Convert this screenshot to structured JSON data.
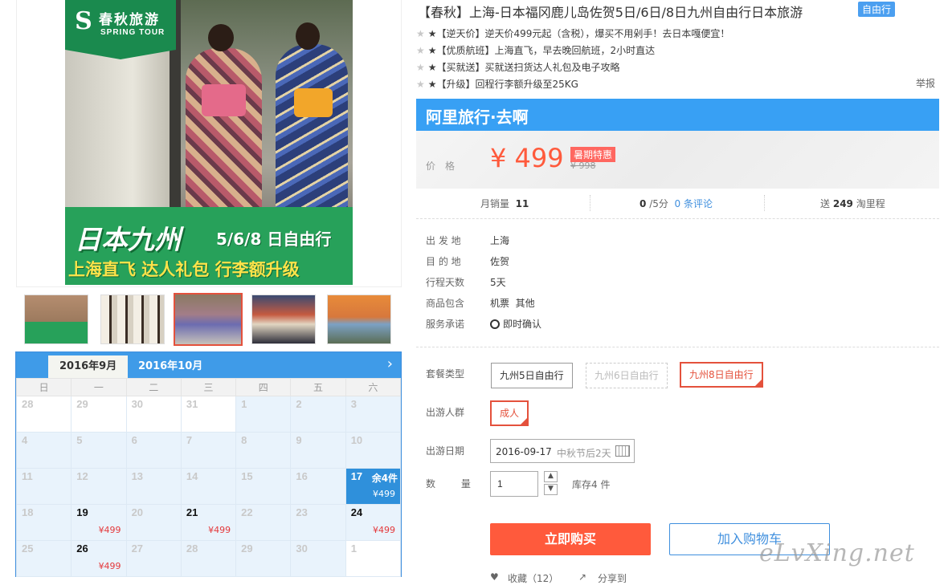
{
  "logo": {
    "mark": "S",
    "name_cn": "春秋旅游",
    "name_en": "SPRING TOUR"
  },
  "banner": {
    "title": "日本九州",
    "subtitle": "5/6/8 日自由行",
    "tagline": "上海直飞  达人礼包  行李额升级"
  },
  "calendar": {
    "tabs": [
      "2016年9月",
      "2016年10月"
    ],
    "next_icon": "chevron-right-icon",
    "weekdays": [
      "日",
      "一",
      "二",
      "三",
      "四",
      "五",
      "六"
    ],
    "weeks": [
      [
        {
          "d": "28",
          "s": "past"
        },
        {
          "d": "29",
          "s": "past"
        },
        {
          "d": "30",
          "s": "past"
        },
        {
          "d": "31",
          "s": "past"
        },
        {
          "d": "1",
          "s": "avail"
        },
        {
          "d": "2",
          "s": "avail"
        },
        {
          "d": "3",
          "s": "avail"
        }
      ],
      [
        {
          "d": "4",
          "s": "avail"
        },
        {
          "d": "5",
          "s": "avail"
        },
        {
          "d": "6",
          "s": "avail"
        },
        {
          "d": "7",
          "s": "avail"
        },
        {
          "d": "8",
          "s": "avail"
        },
        {
          "d": "9",
          "s": "avail"
        },
        {
          "d": "10",
          "s": "avail"
        }
      ],
      [
        {
          "d": "11",
          "s": "avail"
        },
        {
          "d": "12",
          "s": "avail"
        },
        {
          "d": "13",
          "s": "avail"
        },
        {
          "d": "14",
          "s": "avail"
        },
        {
          "d": "15",
          "s": "avail"
        },
        {
          "d": "16",
          "s": "avail"
        },
        {
          "d": "17",
          "s": "selected",
          "price": "¥499",
          "stock": "余4件"
        }
      ],
      [
        {
          "d": "18",
          "s": "avail"
        },
        {
          "d": "19",
          "s": "has",
          "price": "¥499"
        },
        {
          "d": "20",
          "s": "avail"
        },
        {
          "d": "21",
          "s": "has",
          "price": "¥499"
        },
        {
          "d": "22",
          "s": "avail"
        },
        {
          "d": "23",
          "s": "avail"
        },
        {
          "d": "24",
          "s": "has",
          "price": "¥499"
        }
      ],
      [
        {
          "d": "25",
          "s": "avail"
        },
        {
          "d": "26",
          "s": "has",
          "price": "¥499"
        },
        {
          "d": "27",
          "s": "avail"
        },
        {
          "d": "28",
          "s": "avail"
        },
        {
          "d": "29",
          "s": "avail"
        },
        {
          "d": "30",
          "s": "avail"
        },
        {
          "d": "1",
          "s": "past"
        }
      ]
    ]
  },
  "product": {
    "title": "【春秋】上海-日本福冈鹿儿岛佐贺5日/6日/8日九州自由行日本旅游",
    "tag": "自由行",
    "promos": [
      "★【逆天价】逆天价499元起（含税），爆买不用剁手！去日本嘎便宜！",
      "★【优质航班】上海直飞，早去晚回航班，2小时直达",
      "★【买就送】买就送扫货达人礼包及电子攻略",
      "★【升级】回程行李额升级至25KG"
    ],
    "promo_stars": "★",
    "report": "举报"
  },
  "price": {
    "brand": "阿里旅行·去啊",
    "label": "价格",
    "current": "¥ 499",
    "badge": "暑期特惠",
    "original": "¥ 998"
  },
  "stats": {
    "sales_label": "月销量",
    "sales": "11",
    "score": "0",
    "score_unit": "/5分",
    "reviews": "0 条评论",
    "points_label": "送",
    "points": "249",
    "points_unit": "淘里程"
  },
  "info": [
    {
      "k": "出 发 地",
      "v": "上海"
    },
    {
      "k": "目 的 地",
      "v": "佐贺"
    },
    {
      "k": "行程天数",
      "v": "5天"
    },
    {
      "k": "商品包含",
      "v": "机票  其他"
    },
    {
      "k": "服务承诺",
      "v": "即时确认"
    }
  ],
  "options": {
    "package_label": "套餐类型",
    "packages": [
      "九州5日自由行",
      "九州6日自由行",
      "九州8日自由行"
    ],
    "group_label": "出游人群",
    "group": "成人",
    "date_label": "出游日期",
    "date": "2016-09-17",
    "date_hint": "中秋节后2天",
    "qty_label": "数  量",
    "qty": "1",
    "stock": "库存4 件"
  },
  "actions": {
    "buy": "立即购买",
    "cart": "加入购物车",
    "collect": "收藏（12）",
    "share": "分享到"
  },
  "watermark": "eLvXing.net",
  "colors": {
    "accent": "#ff5a3c",
    "blue": "#38a0f4",
    "green": "#27a15a"
  }
}
